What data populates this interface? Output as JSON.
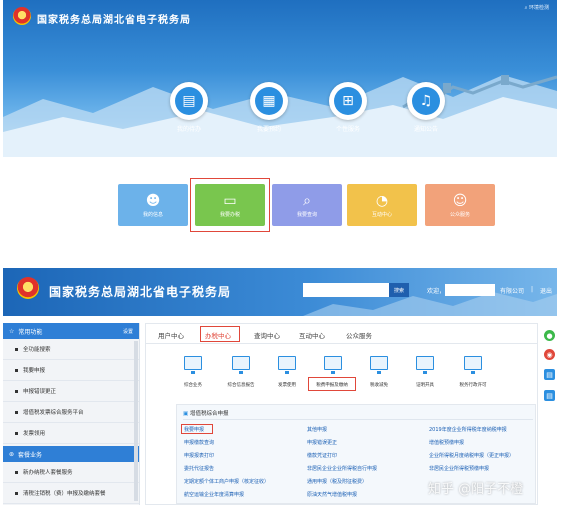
{
  "site_title": "国家税务总局湖北省电子税务局",
  "top_right_link": "环境检测",
  "home_circles": [
    {
      "label": "我的待办",
      "icon": "todo-doc-icon"
    },
    {
      "label": "我要预约",
      "icon": "calendar-icon"
    },
    {
      "label": "个性服务",
      "icon": "grid-icon"
    },
    {
      "label": "通知公告",
      "icon": "bell-icon"
    }
  ],
  "home_tiles": [
    {
      "label": "我的信息",
      "icon": "user-icon",
      "color": "#6cb2ea"
    },
    {
      "label": "我要办税",
      "icon": "monitor-icon",
      "color": "#79c64e"
    },
    {
      "label": "我要查询",
      "icon": "search-doc-icon",
      "color": "#8f9ce8"
    },
    {
      "label": "互动中心",
      "icon": "chat-icon",
      "color": "#f2c24b"
    },
    {
      "label": "公众服务",
      "icon": "service-icon",
      "color": "#f2a27a"
    }
  ],
  "header2": {
    "search_btn": "搜索",
    "welcome": "欢迎，",
    "company": "有限公司",
    "separator": "|",
    "logout": "退出"
  },
  "sidebar": {
    "section1": "常用功能",
    "settings": "设置",
    "section1_items": [
      "全功能搜索",
      "我要申报",
      "申报错误更正",
      "增值税发票综合服务平台",
      "发票领用"
    ],
    "section2": "套餐业务",
    "section2_items": [
      "新办纳税人套餐服务",
      "清税注销税（费）申报及缴纳套餐"
    ]
  },
  "main_tabs": [
    "用户中心",
    "办税中心",
    "查询中心",
    "互动中心",
    "公众服务"
  ],
  "apps": [
    "综合业务",
    "综合信息报告",
    "发票使用",
    "税费申报及缴纳",
    "税收减免",
    "证明开具",
    "税务行政许可"
  ],
  "panel_title": "增值税综合申报",
  "links_col1": [
    "我要申报",
    "申报缴款查询",
    "申报报表打印",
    "委托代征报告",
    "定期定额个体工商户申报（核定征收）",
    "航空运输企业年度清算申报"
  ],
  "links_col2": [
    "其他申报",
    "申报错误更正",
    "缴款凭证打印",
    "非居民企业企业所得税自行申报",
    "通用申报（税及附征税费）",
    "原油天然气增值税申报"
  ],
  "links_col3": [
    "2019年度企业所得税年度纳税申报",
    "增值税预缴申报",
    "企业所得税月度纳税申报（更正申报）",
    "非居民企业所得税预缴申报",
    "",
    ""
  ],
  "watermark": "知乎 @阳子不橙"
}
